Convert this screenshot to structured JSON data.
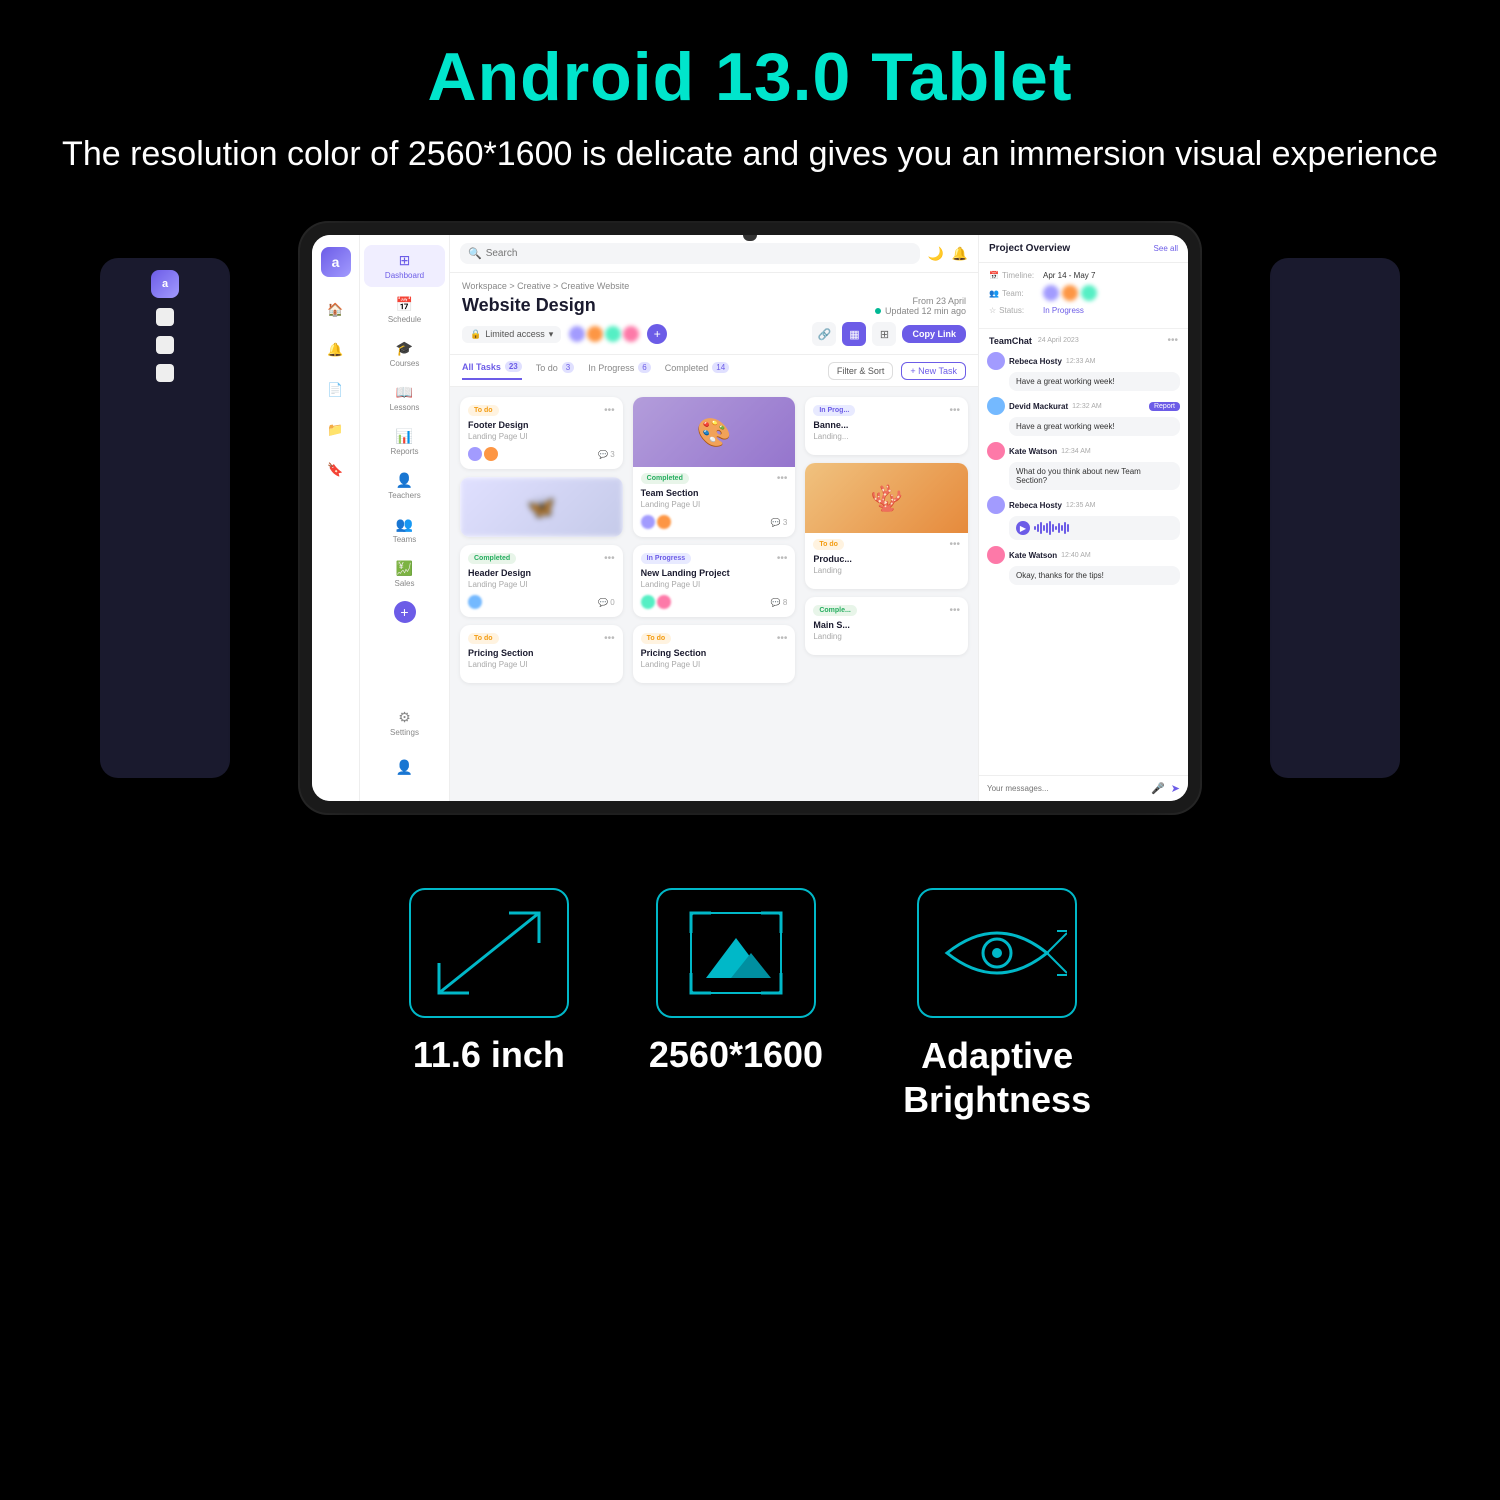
{
  "hero": {
    "title": "Android 13.0 Tablet",
    "subtitle": "The resolution color of 2560*1600 is delicate and gives you an immersion visual experience"
  },
  "tablet": {
    "topbar": {
      "search_placeholder": "Search",
      "search_icon": "search-icon",
      "moon_icon": "moon-icon",
      "bell_icon": "bell-icon"
    },
    "breadcrumb": "Workspace  >  Creative  >  Creative Website",
    "project_date": "From 23 April",
    "updated": "Updated 12 min ago",
    "project_title": "Website Design",
    "access_label": "Limited access",
    "copy_link": "Copy Link",
    "tabs": [
      {
        "label": "All Tasks",
        "count": "23",
        "active": true
      },
      {
        "label": "To do",
        "count": "3",
        "active": false
      },
      {
        "label": "In Progress",
        "count": "6",
        "active": false
      },
      {
        "label": "Completed",
        "count": "14",
        "active": false
      }
    ],
    "filter_label": "Filter & Sort",
    "new_task_label": "+ New Task",
    "kanban": {
      "col1": [
        {
          "status": "To do",
          "status_class": "status-todo",
          "title": "Footer Design",
          "subtitle": "Landing Page UI",
          "comments": "3"
        },
        {
          "status": "Completed",
          "status_class": "status-completed",
          "title": "Header Design",
          "subtitle": "Landing Page UI",
          "comments": "0"
        },
        {
          "status": "To do",
          "status_class": "status-todo",
          "title": "Pricing Section",
          "subtitle": "Landing Page UI",
          "comments": ""
        }
      ],
      "col2": [
        {
          "status": "Completed",
          "status_class": "status-completed",
          "title": "Team Section",
          "subtitle": "Landing Page UI",
          "comments": "3",
          "has_image": true,
          "image_color": "#b39ddb"
        },
        {
          "status": "In Progress",
          "status_class": "status-inprogress",
          "title": "New Landing Project",
          "subtitle": "Landing Page UI",
          "comments": "8"
        },
        {
          "status": "To do",
          "status_class": "status-todo",
          "title": "Pricing Section",
          "subtitle": "Landing Page UI",
          "comments": ""
        }
      ],
      "col3": [
        {
          "status": "In Progress",
          "status_class": "status-inprogress",
          "title": "Banne...",
          "subtitle": "Landing...",
          "comments": ""
        },
        {
          "status": "To do",
          "status_class": "status-todo",
          "title": "Produc...",
          "subtitle": "Landing",
          "comments": "",
          "has_image": true,
          "image_color": "#f0c27f"
        },
        {
          "status": "Comple...",
          "status_class": "status-completed",
          "title": "Main S...",
          "subtitle": "Landing",
          "comments": ""
        }
      ]
    },
    "sidebar": {
      "items": [
        {
          "label": "Dashboard",
          "icon": "⊞",
          "active": true
        },
        {
          "label": "Schedule",
          "icon": "📅"
        },
        {
          "label": "Courses",
          "icon": "📚"
        },
        {
          "label": "Lessons",
          "icon": "📖"
        },
        {
          "label": "Reports",
          "icon": "📊"
        },
        {
          "label": "Teachers",
          "icon": "👤"
        },
        {
          "label": "Teams",
          "icon": "👥"
        },
        {
          "label": "Sales",
          "icon": "💰"
        },
        {
          "label": "Settings",
          "icon": "⚙"
        }
      ]
    },
    "right_panel": {
      "title": "Project Overview",
      "see_all": "See all",
      "timeline_label": "Timeline:",
      "timeline_value": "Apr 14 - May 7",
      "team_label": "Team:",
      "status_label": "Status:",
      "status_value": "In Progress",
      "teamchat_title": "TeamChat",
      "teamchat_date": "24 April 2023",
      "messages": [
        {
          "name": "Rebeca Hosty",
          "time": "12:33 AM",
          "text": "Have a great working week!",
          "avatar_color": "#a29bfe"
        },
        {
          "name": "Devid Mackurat",
          "time": "12:32 AM",
          "text": "Have a great working week!",
          "avatar_color": "#74b9ff",
          "badge": "Report"
        },
        {
          "name": "Kate Watson",
          "time": "12:34 AM",
          "text": "What do you think about new Team Section?",
          "avatar_color": "#fd79a8"
        },
        {
          "name": "Rebeca Hosty",
          "time": "12:35 AM",
          "text": "audio",
          "avatar_color": "#a29bfe"
        },
        {
          "name": "Kate Watson",
          "time": "12:40 AM",
          "text": "Okay, thanks for the tips!",
          "avatar_color": "#fd79a8"
        }
      ],
      "chat_placeholder": "Your messages..."
    }
  },
  "features": [
    {
      "icon_type": "diagonal",
      "label": "11.6 inch"
    },
    {
      "icon_type": "screen",
      "label": "2560*1600"
    },
    {
      "icon_type": "eye",
      "label": "Adaptive\nBrightness"
    }
  ]
}
